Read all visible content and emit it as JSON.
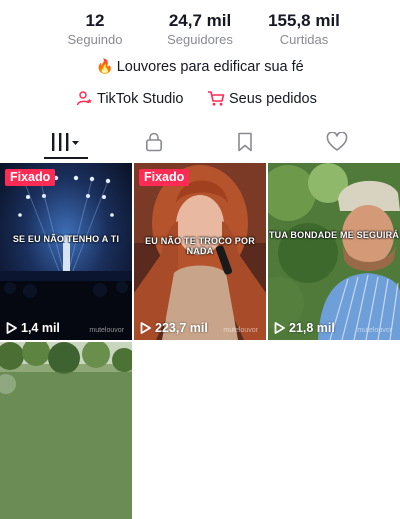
{
  "stats": [
    {
      "value": "12",
      "label": "Seguindo"
    },
    {
      "value": "24,7 mil",
      "label": "Seguidores"
    },
    {
      "value": "155,8 mil",
      "label": "Curtidas"
    }
  ],
  "bio": {
    "emoji": "🔥",
    "text": "Louvores para edificar sua fé"
  },
  "links": {
    "studio": "TikTok Studio",
    "orders": "Seus pedidos"
  },
  "tabs": [
    {
      "name": "videos-tab",
      "icon": "grid-icon",
      "active": true
    },
    {
      "name": "private-tab",
      "icon": "lock-icon",
      "active": false
    },
    {
      "name": "favorites-tab",
      "icon": "bookmark-icon",
      "active": false
    },
    {
      "name": "liked-tab",
      "icon": "heart-icon",
      "active": false
    }
  ],
  "videos": [
    {
      "pinned_label": "Fixado",
      "caption": "SE EU NÃO TENHO A TI",
      "views": "1,4 mil",
      "watermark": "mutelouvor"
    },
    {
      "pinned_label": "Fixado",
      "caption": "EU NÃO TE TROCO POR NADA",
      "views": "223,7 mil",
      "watermark": "mutelouvor"
    },
    {
      "pinned_label": "",
      "caption": "TUA BONDADE ME SEGUIRÁ",
      "views": "21,8 mil",
      "watermark": "mutelouvor"
    },
    {
      "pinned_label": "",
      "caption": "",
      "views": "",
      "watermark": ""
    }
  ],
  "colors": {
    "accent": "#fe2c55",
    "text": "#161823",
    "muted": "#8a8b91"
  }
}
